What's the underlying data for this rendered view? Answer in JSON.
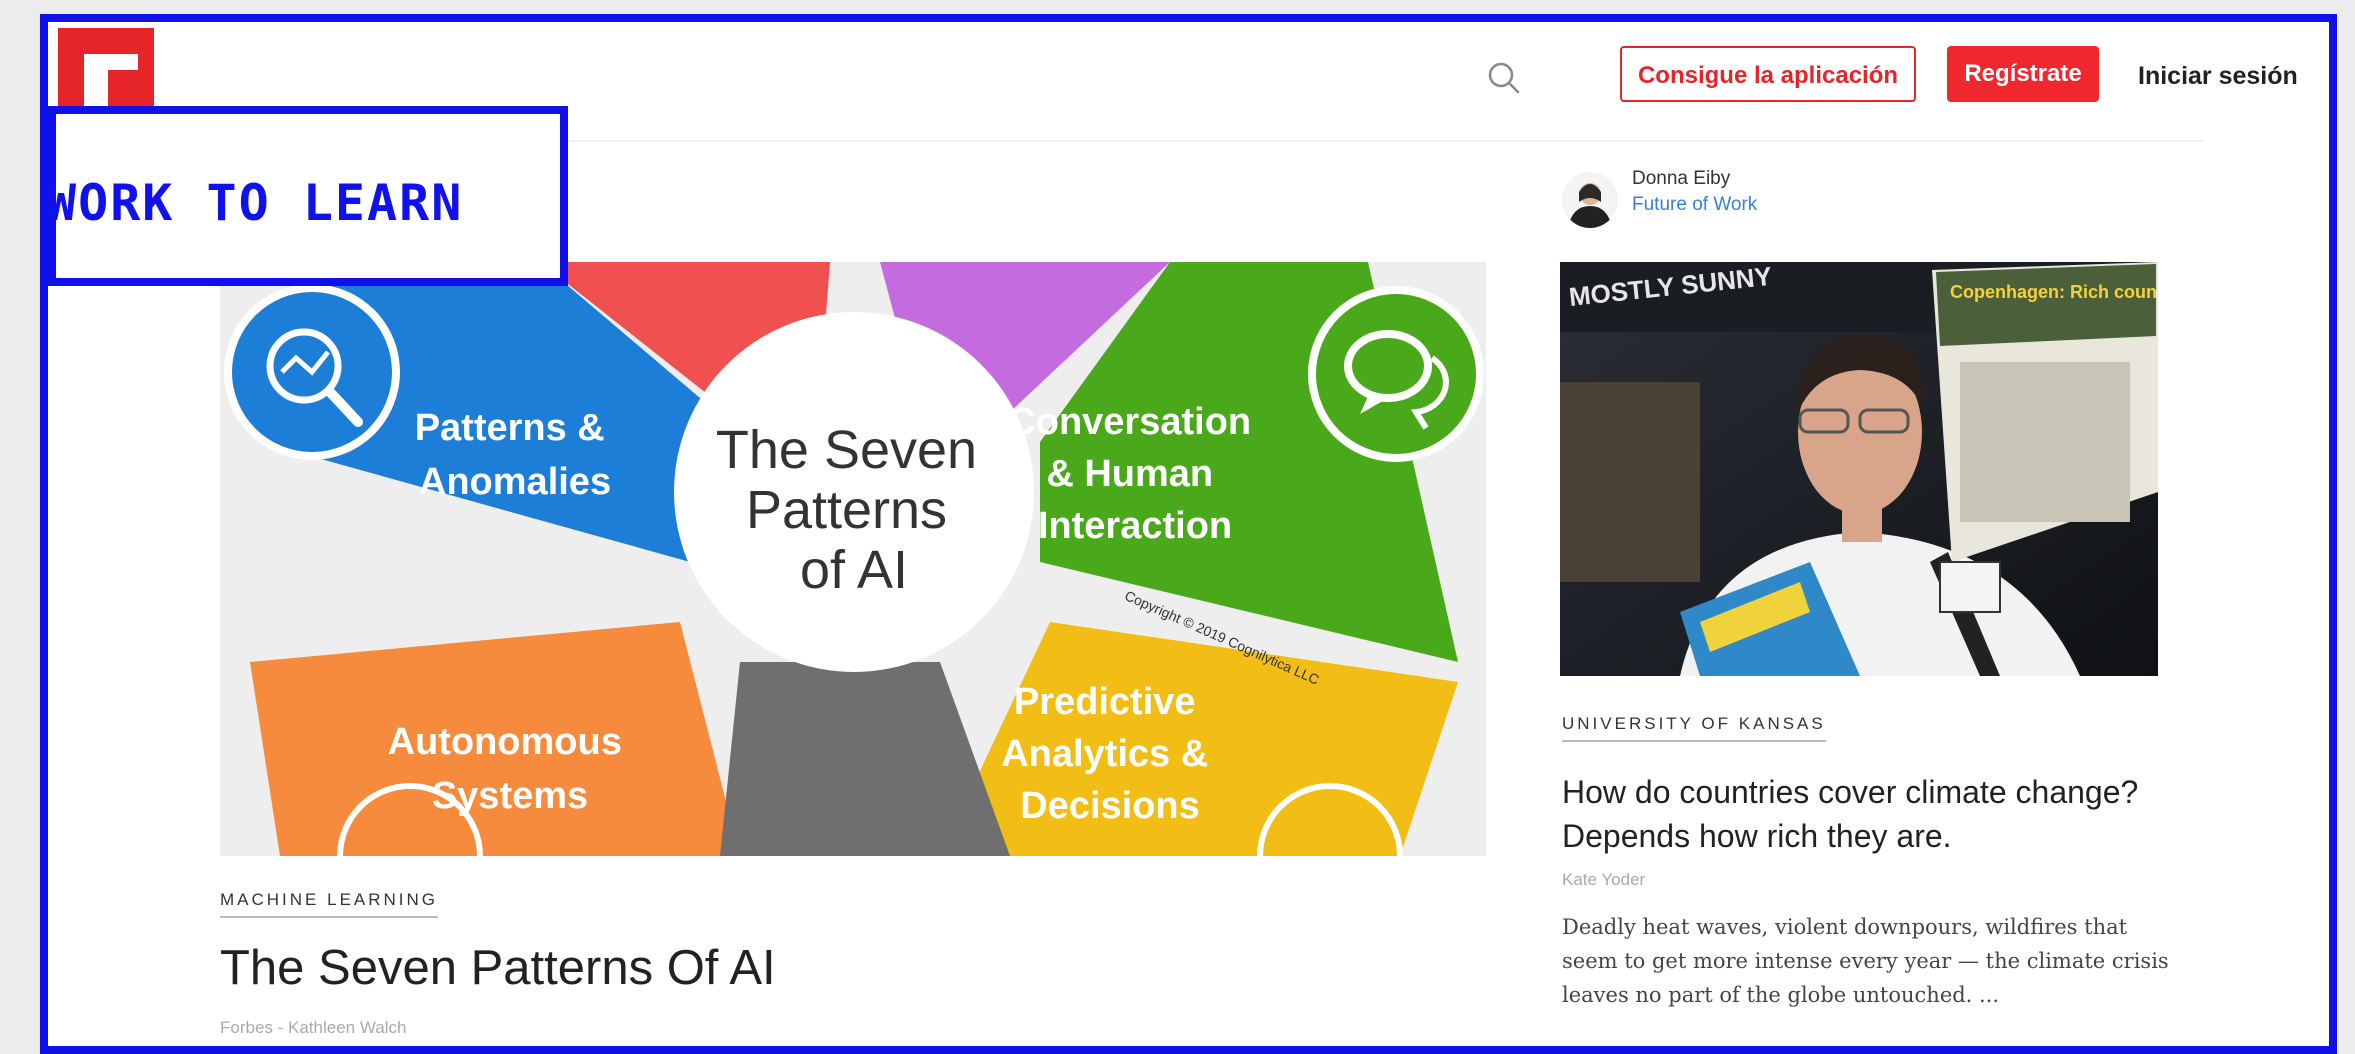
{
  "header": {
    "get_app": "Consigue la aplicación",
    "register": "Regístrate",
    "login": "Iniciar sesión"
  },
  "badge": {
    "text": "WORK TO LEARN"
  },
  "main_article": {
    "image": {
      "center_title": [
        "The Seven",
        "Patterns",
        "of AI"
      ],
      "segments": {
        "patterns": [
          "Patterns &",
          "Anomalies"
        ],
        "conversation": [
          "Conversation",
          "& Human",
          "Interaction"
        ],
        "autonomous": [
          "Autonomous",
          "Systems"
        ],
        "predictive": [
          "Predictive",
          "Analytics &",
          "Decisions"
        ]
      },
      "copyright": "Copyright © 2019 Cognilytica LLC",
      "colors": {
        "blue": "#1d7ed8",
        "green": "#4aa81b",
        "orange": "#f68a3d",
        "yellow": "#f2bd14",
        "red": "#f0504f",
        "purple": "#c56be0",
        "gray": "#6f6f6f"
      }
    },
    "category": "MACHINE LEARNING",
    "title": "The Seven Patterns Of AI",
    "byline": "Forbes - Kathleen Walch"
  },
  "sidebar": {
    "author_name": "Donna Eiby",
    "author_magazine": "Future of Work",
    "photo": {
      "sign_top": "MOSTLY SUNNY",
      "paper_headline": "Copenhagen: Rich countries' pitch global suicide pact"
    },
    "category": "UNIVERSITY OF KANSAS",
    "title": "How do countries cover climate change? Depends how rich they are.",
    "byline": "Kate Yoder",
    "excerpt": "Deadly heat waves, violent downpours, wildfires that seem to get more intense every year — the climate crisis leaves no part of the globe untouched. ..."
  }
}
